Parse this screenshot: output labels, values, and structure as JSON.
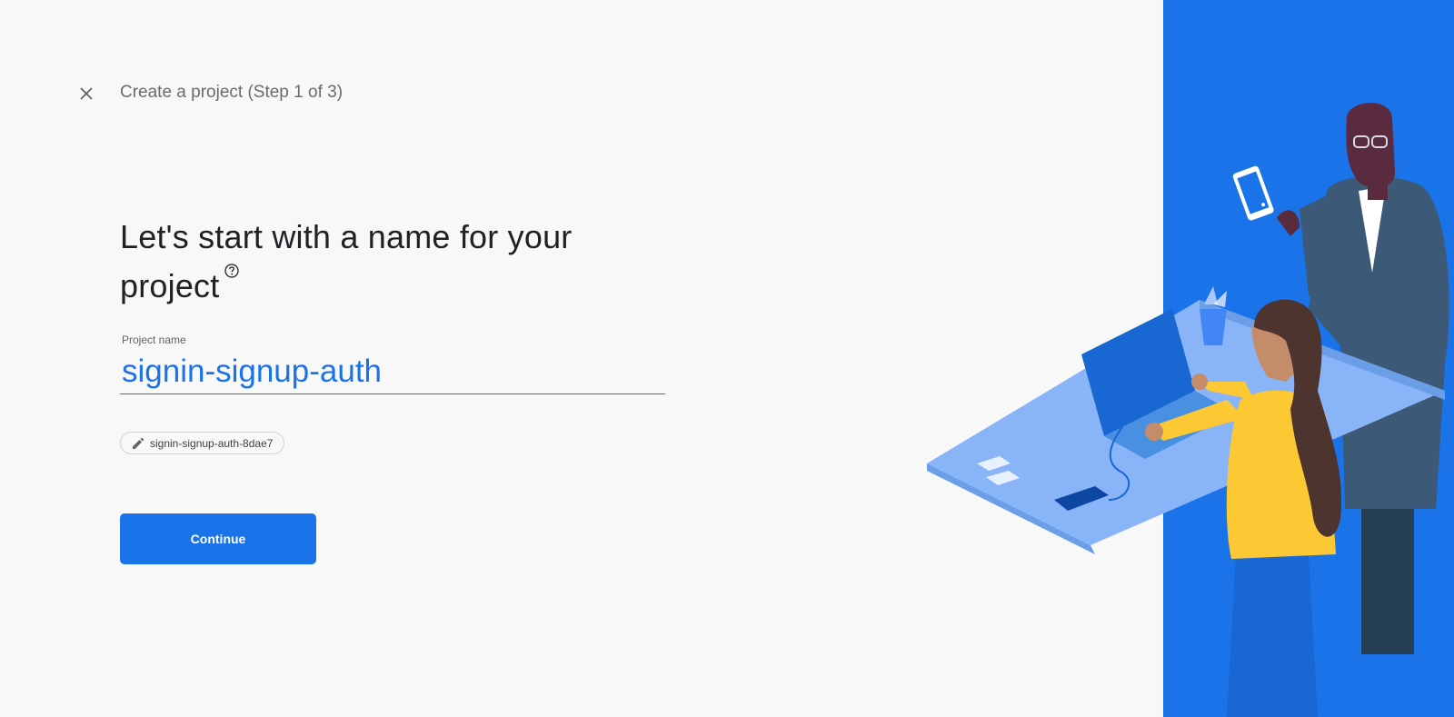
{
  "header": {
    "close_icon": "close-icon",
    "title": "Create a project (Step 1 of 3)"
  },
  "main": {
    "heading": "Let's start with a name for your project",
    "help_icon": "help-circle-icon",
    "project_name": {
      "label": "Project name",
      "value": "signin-signup-auth"
    },
    "project_id": {
      "icon": "edit-pencil-icon",
      "value": "signin-signup-auth-8dae7"
    },
    "continue_label": "Continue"
  },
  "colors": {
    "accent": "#1a73e8",
    "background": "#f8f8f8",
    "panel": "#1a73e8"
  }
}
